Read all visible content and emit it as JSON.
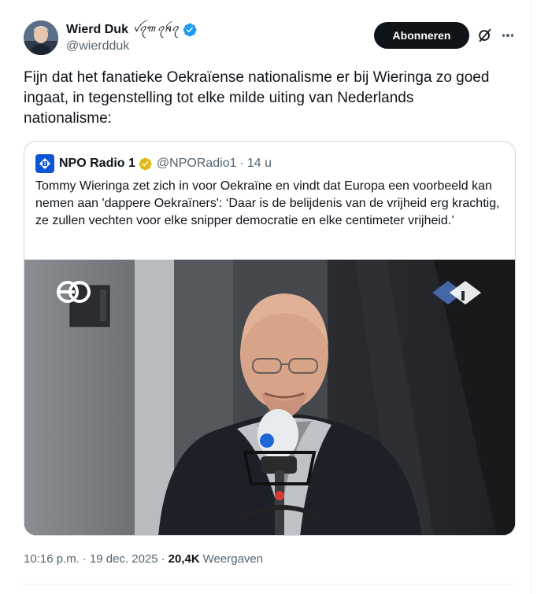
{
  "author": {
    "display_name": "Wierd Duk",
    "name_script": "ꪜꪖ꧑ ꪖꫝꪖ",
    "handle": "@wierdduk",
    "verified_icon": "verified-badge-icon",
    "verified_color": "#1d9bf0"
  },
  "header": {
    "subscribe_label": "Abonneren",
    "grok_icon": "grok-icon",
    "more_icon": "more-options-icon"
  },
  "tweet": {
    "text": "Fijn dat het fanatieke Oekraïense nationalisme er bij Wieringa zo goed ingaat, in tegenstelling tot elke milde uiting van Nederlands nationalisme:"
  },
  "quote": {
    "display_name": "NPO Radio 1",
    "handle": "@NPORadio1",
    "time": "14 u",
    "badge_color": "#e2b719",
    "text": "Tommy Wieringa zet zich in voor Oekraïne en vindt dat Europa een voorbeeld kan nemen aan 'dappere Oekraïners': ‘Daar is de belijdenis van de vrijheid erg krachtig, ze zullen vechten voor elke snipper democratie en elke centimeter vrijheid.’",
    "media": {
      "broadcaster_logo": "eo",
      "radio_logo": "npo radio 1"
    }
  },
  "meta": {
    "time": "10:16 p.m.",
    "date": "19 dec. 2025",
    "views_count": "20,4K",
    "views_label": "Weergaven"
  }
}
